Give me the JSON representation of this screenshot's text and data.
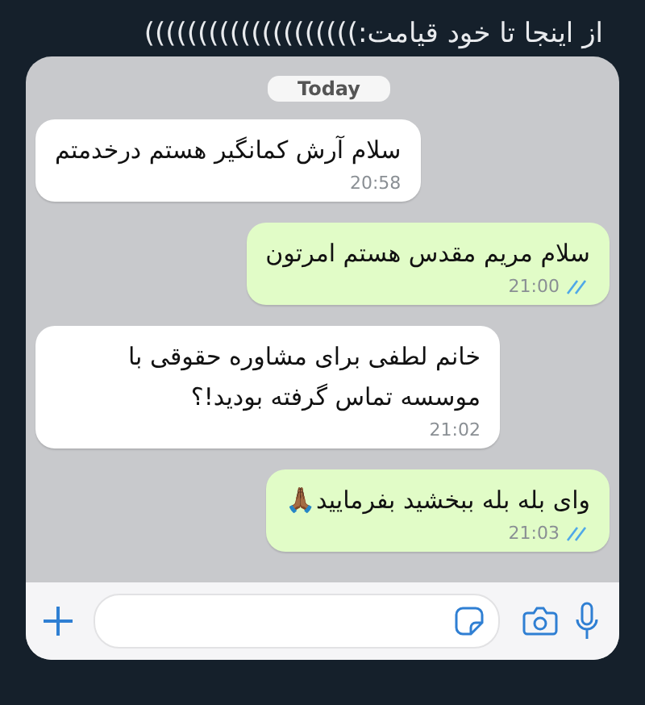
{
  "post_caption": "از اینجا تا خود قیامت:))))))))))))))))))))",
  "chat": {
    "date_label": "Today",
    "messages": [
      {
        "kind": "incoming",
        "text": "سلام آرش کمانگیر هستم درخدمتم",
        "time": "20:58"
      },
      {
        "kind": "outgoing",
        "text": "سلام مریم مقدس هستم امرتون",
        "time": "21:00",
        "read": true
      },
      {
        "kind": "incoming",
        "text": "خانم لطفی برای مشاوره حقوقی با موسسه تماس گرفته بودید!؟",
        "time": "21:02"
      },
      {
        "kind": "outgoing",
        "text": "وای بله بله ببخشید بفرمایید🙏🏾",
        "time": "21:03",
        "read": true
      }
    ]
  }
}
